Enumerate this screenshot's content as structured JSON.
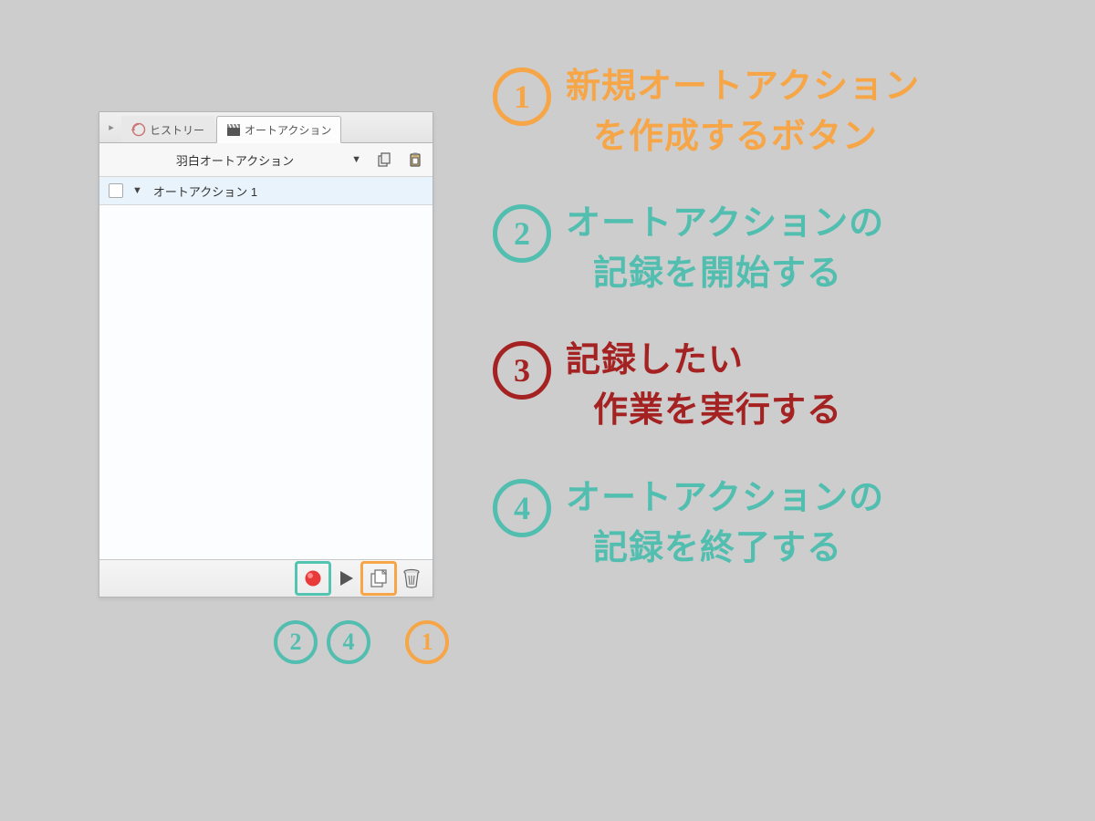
{
  "panel": {
    "tabs": {
      "history": "ヒストリー",
      "auto_action": "オートアクション"
    },
    "set_name": "羽白オートアクション",
    "action_item": "オートアクション 1"
  },
  "footer_labels": {
    "under_record": "②④",
    "under_new": "①"
  },
  "annotations": [
    {
      "n": "1",
      "color": "orange",
      "line1": "新規オートアクション",
      "line2": "を作成するボタン"
    },
    {
      "n": "2",
      "color": "teal",
      "line1": "オートアクションの",
      "line2": "記録を開始する"
    },
    {
      "n": "3",
      "color": "red",
      "line1": "記録したい",
      "line2": "作業を実行する"
    },
    {
      "n": "4",
      "color": "teal",
      "line1": "オートアクションの",
      "line2": "記録を終了する"
    }
  ]
}
